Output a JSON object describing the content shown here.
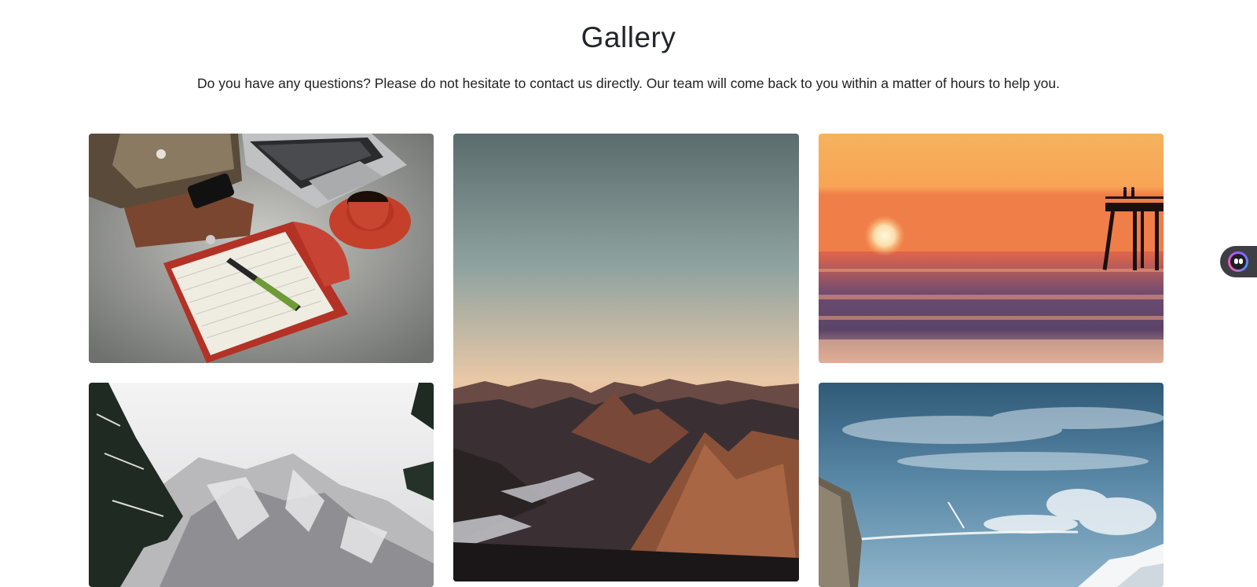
{
  "gallery": {
    "title": "Gallery",
    "description": "Do you have any questions? Please do not hesitate to contact us directly. Our team will come back to you within a matter of hours to help you."
  },
  "images": [
    {
      "name": "desk-workspace-image"
    },
    {
      "name": "mountain-sunset-image"
    },
    {
      "name": "ocean-pier-sunset-image"
    },
    {
      "name": "snowy-mountain-image"
    },
    {
      "name": "blue-sky-valley-image"
    }
  ],
  "chat_widget": {
    "icon": "chat-bot-icon"
  },
  "colors": {
    "background": "#ffffff",
    "text": "#212529",
    "widget": "#3d3f44"
  }
}
